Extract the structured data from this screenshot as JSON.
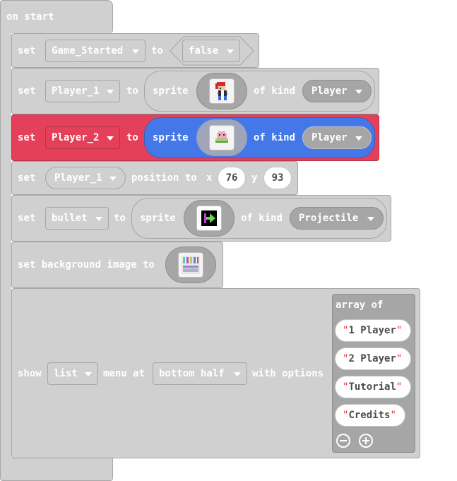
{
  "on_start": {
    "label": "on start"
  },
  "blocks": {
    "set_game_started": {
      "set": "set",
      "variable": "Game_Started",
      "to": "to",
      "value": "false"
    },
    "set_player1_sprite": {
      "set": "set",
      "variable": "Player_1",
      "to": "to",
      "sprite": "sprite",
      "of_kind": "of kind",
      "kind": "Player",
      "image_icon": "pixel-character-icon"
    },
    "set_player2_sprite": {
      "set": "set",
      "variable": "Player_2",
      "to": "to",
      "sprite": "sprite",
      "of_kind": "of kind",
      "kind": "Player",
      "image_icon": "pink-blob-icon",
      "accent_color": "#e4405a",
      "sprite_color": "#4478e8"
    },
    "set_position": {
      "set": "set",
      "variable": "Player_1",
      "position_to": "position to",
      "x_label": "x",
      "x_value": "76",
      "y_label": "y",
      "y_value": "93"
    },
    "set_bullet": {
      "set": "set",
      "variable": "bullet",
      "to": "to",
      "sprite": "sprite",
      "of_kind": "of kind",
      "kind": "Projectile",
      "image_icon": "arrow-projectile-icon"
    },
    "set_background": {
      "label": "set background image to",
      "image_icon": "background-tile-icon"
    },
    "show_menu": {
      "show": "show",
      "menu_type": "list",
      "menu_at": "menu at",
      "position": "bottom half",
      "with_options": "with options",
      "array_label": "array of",
      "options": [
        "1 Player",
        "2 Player",
        "Tutorial",
        "Credits"
      ],
      "remove_icon": "minus-circle-icon",
      "add_icon": "plus-circle-icon"
    }
  },
  "colors": {
    "block_gray": "#d0d0d0",
    "highlight_red": "#e4405a",
    "sprite_blue": "#4478e8"
  }
}
